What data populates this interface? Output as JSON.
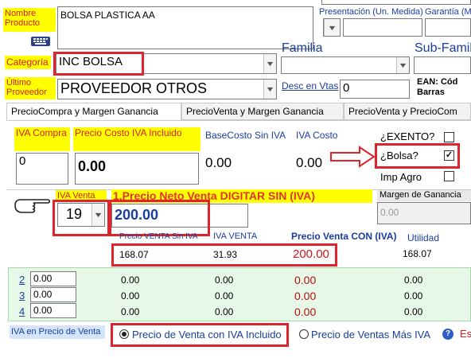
{
  "top": {
    "nombre_label": "Nombre Producto",
    "nombre_value": "BOLSA PLASTICA AA",
    "presentacion_label": "Presentación (Un. Medida)",
    "garantia_label": "Garantía (Me",
    "categoria_label": "Categoría",
    "categoria_value": "INC BOLSA",
    "familia_label": "Familia",
    "subfamilia_label": "Sub-Famili",
    "proveedor_label": "Último Proveedor",
    "proveedor_value": "PROVEEDOR OTROS",
    "desc_label": "Desc en Vtas",
    "desc_value": "0",
    "ean_label": "EAN: Cód Barras"
  },
  "tabs": [
    {
      "label": "PrecioCompra y Margen Ganancia"
    },
    {
      "label": "PrecioVenta y Margen Ganancia"
    },
    {
      "label": "PrecioVenta y PrecioCom"
    }
  ],
  "compra": {
    "iva_label": "IVA Compra",
    "iva_value": "0",
    "costo_label": "Precio Costo IVA Incluido",
    "costo_value": "0.00",
    "base_label": "BaseCosto Sin IVA",
    "base_value": "0.00",
    "ivacosto_label": "IVA Costo",
    "ivacosto_value": "0.00",
    "exento_label": "¿EXENTO?",
    "bolsa_label": "¿Bolsa?",
    "bolsa_checked": "✓",
    "impagro_label": "Imp Agro"
  },
  "venta": {
    "iva_label": "IVA Venta",
    "iva_value": "19",
    "neto_label": "1.Precio Neto Venta DIGITAR SIN (IVA)",
    "neto_value": "200.00",
    "margen_label": "Margen de Ganancia",
    "margen_value": "0.00",
    "psiniva_label": "Precio VENTA Sin IVA",
    "ivaventa_label": "IVA VENTA",
    "pconiva_label": "Precio Venta CON (IVA)",
    "utilidad_label": "Utilidad",
    "psiniva_value": "168.07",
    "ivaventa_value": "31.93",
    "pconiva_value": "200.00",
    "utilidad_value": "168.07"
  },
  "rows": [
    {
      "num": "2",
      "input": "0.00",
      "a": "0.00",
      "b": "0.00",
      "c": "0.00",
      "d": "0.00"
    },
    {
      "num": "3",
      "input": "0.00",
      "a": "0.00",
      "b": "0.00",
      "c": "0.00",
      "d": "0.00"
    },
    {
      "num": "4",
      "input": "0.00",
      "a": "0.00",
      "b": "0.00",
      "c": "0.00",
      "d": "0.00"
    }
  ],
  "bottom": {
    "iva_precio_label": "IVA en Precio de Venta",
    "opt_incluido": "Precio de Venta con IVA Incluido",
    "opt_mas": "Precio de Ventas Más IVA",
    "help": "?",
    "trailing": "Es"
  },
  "colors": {
    "highlight": "#ffff00",
    "annotation_red": "#e0242c",
    "label_blue": "#1a3d9e"
  }
}
